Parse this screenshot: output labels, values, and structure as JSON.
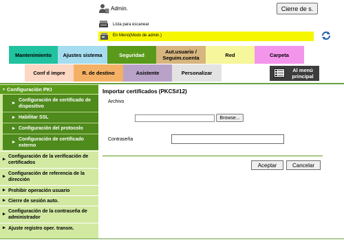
{
  "header": {
    "user_label": "Admin.",
    "user_icon": "admin-user-icon",
    "logout_label": "Cierre de s.",
    "scan_label": "Lista para escanear",
    "scan_icon": "scanner-icon",
    "mode_label": "En Menú(Modo de admin.)",
    "mode_icon": "machine-icon",
    "mode_bar_color": "#f6f600",
    "refresh_icon": "refresh-icon"
  },
  "tabs_row1": [
    {
      "label": "Mantenimiento",
      "color": "#20c2a0"
    },
    {
      "label": "Ajustes sistema",
      "color": "#a6dcef"
    },
    {
      "label": "Seguridad",
      "color": "#5a9a1b",
      "selected": true
    },
    {
      "label": "Aut.usuario / Seguim.cuenta",
      "color": "#d7b57f"
    },
    {
      "label": "Red",
      "color": "#f6f69c"
    },
    {
      "label": "Carpeta",
      "color": "#f495ec"
    }
  ],
  "tabs_row2": [
    {
      "label": "Conf d impre",
      "color": "#fcd7c4"
    },
    {
      "label": "R. de destino",
      "color": "#f4b166"
    },
    {
      "label": "Asistente",
      "color": "#b8a2c8"
    },
    {
      "label": "Personalizar",
      "color": "#e3e3e3"
    }
  ],
  "menu_button": {
    "label": "Al menú principal",
    "icon": "main-menu-icon"
  },
  "sidebar": {
    "section_title": "Configuración PKI",
    "sub_items": [
      {
        "label": "Configuración de certificado de dispositivo"
      },
      {
        "label": "Habilitar SSL"
      },
      {
        "label": "Configuración del protocolo"
      },
      {
        "label": "Configuración de certificado externo"
      }
    ],
    "items": [
      {
        "label": "Configuración de la verificación de certificados"
      },
      {
        "label": "Configuración de referencia de la dirección"
      },
      {
        "label": "Prohibir operación usuario"
      },
      {
        "label": "Cierre de sesión auto."
      },
      {
        "label": "Configuración de la contraseña de administrador"
      },
      {
        "label": "Ajuste registro oper. transm."
      }
    ]
  },
  "main": {
    "title": "Importar certificados (PKCS#12)",
    "file_label": "Archivo",
    "file_value": "",
    "browse_label": "Browse...",
    "password_label": "Contraseña",
    "password_value": "",
    "accept_label": "Aceptar",
    "cancel_label": "Cancelar"
  },
  "accent_color": "#5a9a1b"
}
